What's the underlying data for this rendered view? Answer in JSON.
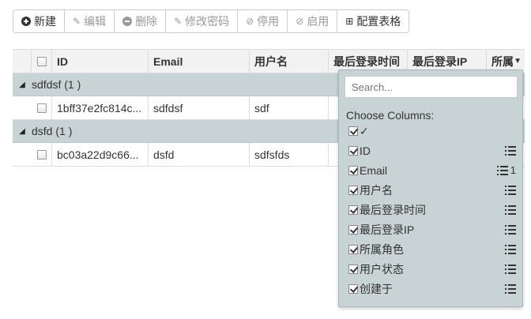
{
  "toolbar": {
    "new": "新建",
    "edit": "编辑",
    "delete": "删除",
    "change_password": "修改密码",
    "disable": "停用",
    "enable": "启用",
    "configure_table": "配置表格"
  },
  "grid": {
    "columns": [
      "ID",
      "Email",
      "用户名",
      "最后登录时间",
      "最后登录IP",
      "所属"
    ],
    "groups": [
      {
        "label": "sdfdsf (1 )",
        "rows": [
          {
            "id": "1bff37e2fc814c...",
            "email": "sdfdsf",
            "username": "sdf"
          }
        ]
      },
      {
        "label": "dsfd (1 )",
        "rows": [
          {
            "id": "bc03a22d9c66...",
            "email": "dsfd",
            "username": "sdfsfds"
          }
        ]
      }
    ]
  },
  "chooser": {
    "search_placeholder": "Search...",
    "caption": "Choose Columns:",
    "options": [
      {
        "label": "✓",
        "grouped": false
      },
      {
        "label": "ID",
        "grouped": false
      },
      {
        "label": "Email",
        "grouped": true,
        "group_index": "1"
      },
      {
        "label": "用户名",
        "grouped": false
      },
      {
        "label": "最后登录时间",
        "grouped": false
      },
      {
        "label": "最后登录IP",
        "grouped": false
      },
      {
        "label": "所属角色",
        "grouped": false
      },
      {
        "label": "用户状态",
        "grouped": false
      },
      {
        "label": "创建于",
        "grouped": false
      }
    ]
  }
}
